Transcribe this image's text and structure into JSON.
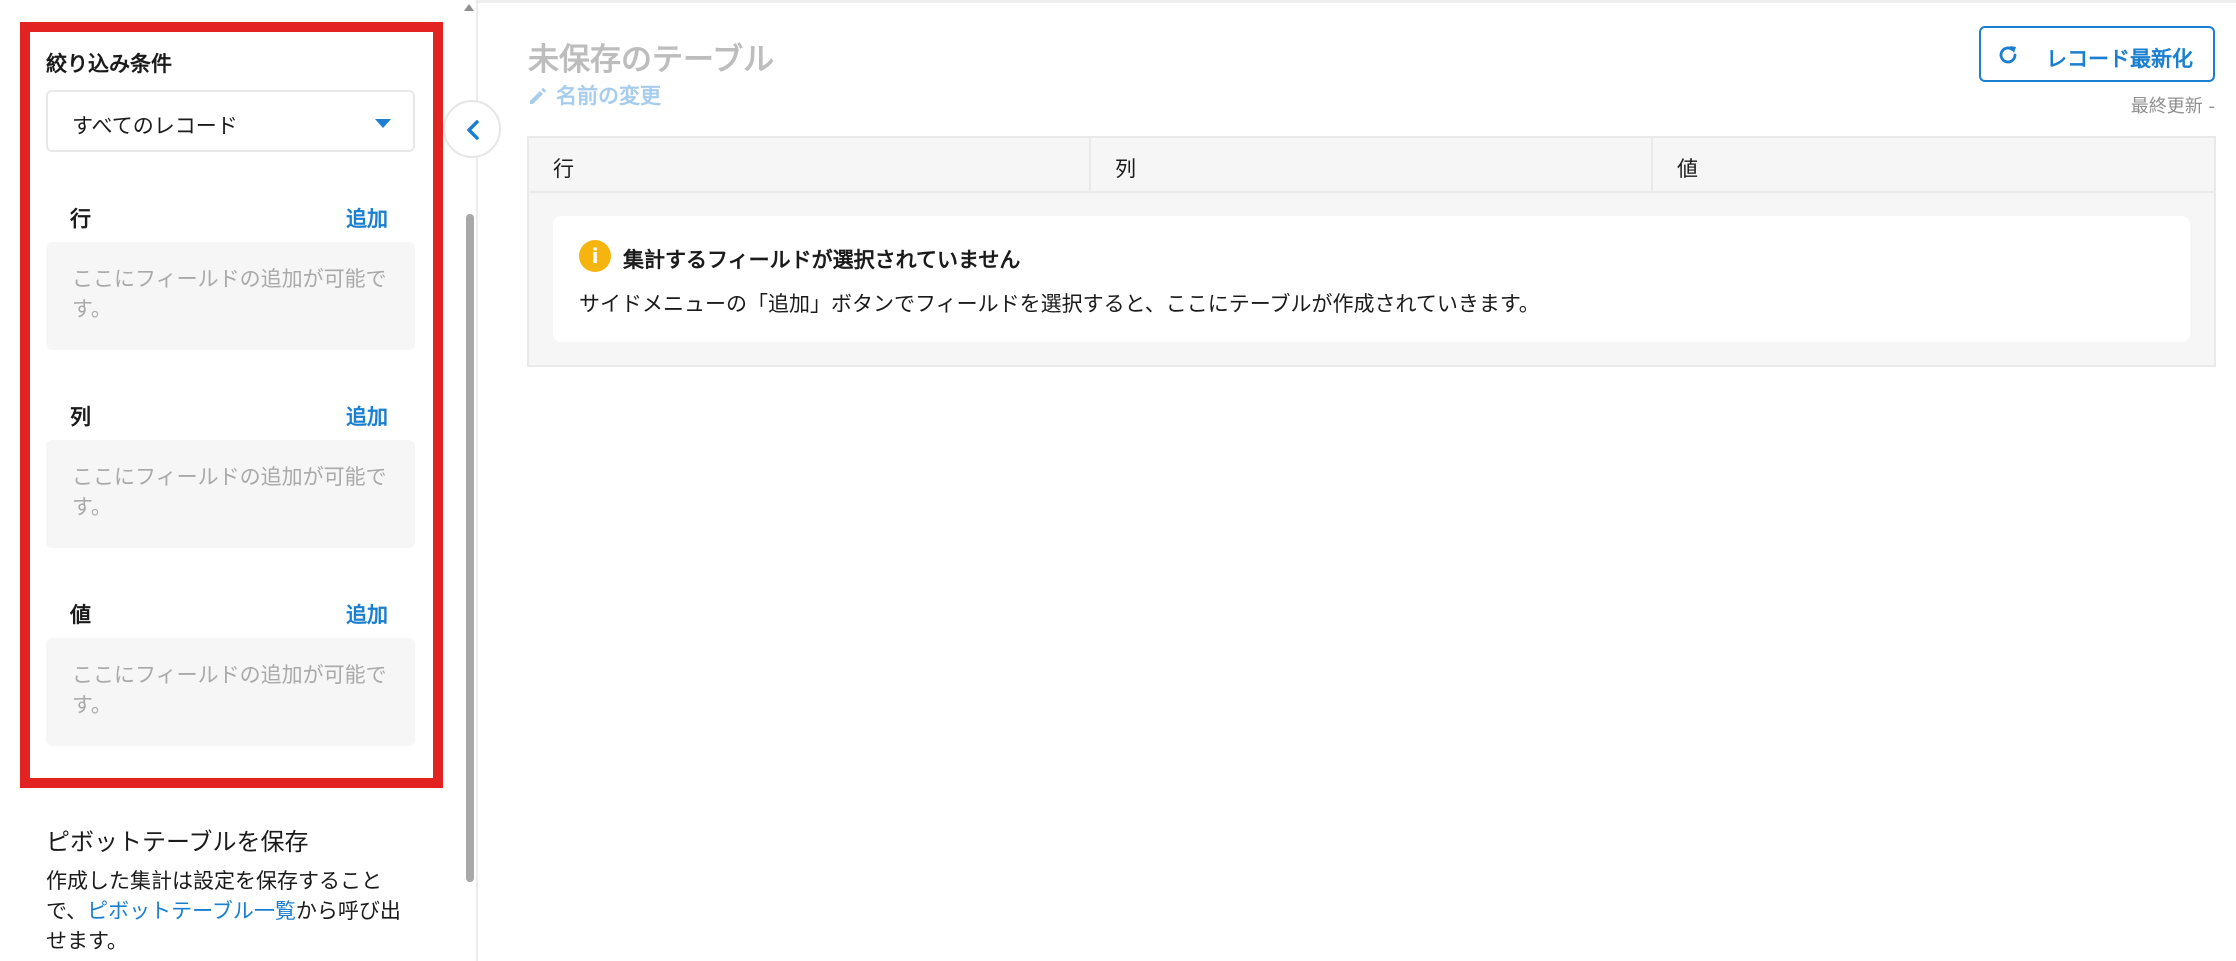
{
  "sidebar": {
    "filter_title": "絞り込み条件",
    "filter_selected": "すべてのレコード",
    "sections": [
      {
        "label": "行",
        "add_label": "追加",
        "placeholder_line1": "ここにフィールドの追加が可能で",
        "placeholder_line2": "す。"
      },
      {
        "label": "列",
        "add_label": "追加",
        "placeholder_line1": "ここにフィールドの追加が可能で",
        "placeholder_line2": "す。"
      },
      {
        "label": "値",
        "add_label": "追加",
        "placeholder_line1": "ここにフィールドの追加が可能で",
        "placeholder_line2": "す。"
      }
    ],
    "save": {
      "title": "ピボットテーブルを保存",
      "desc_line1": "作成した集計は設定を保存すること",
      "desc_line2_prefix": "で、",
      "desc_link": "ピボットテーブル一覧",
      "desc_line2_suffix": "から呼び出",
      "desc_line3": "せます。"
    }
  },
  "main": {
    "title": "未保存のテーブル",
    "rename_label": "名前の変更",
    "refresh_label": "レコード最新化",
    "last_updated": "最終更新 -",
    "table_headers": [
      "行",
      "列",
      "値"
    ],
    "notice": {
      "title": "集計するフィールドが選択されていません",
      "body": "サイドメニューの「追加」ボタンでフィールドを選択すると、ここにテーブルが作成されていきます。"
    }
  },
  "icons": {
    "caret": "caret-down-icon",
    "collapse": "chevron-left-icon",
    "rename": "pencil-icon",
    "refresh": "refresh-icon",
    "info": "info-icon"
  },
  "colors": {
    "accent": "#1a7fd0",
    "highlight": "#e32222",
    "info": "#f5b50e",
    "title_muted": "#bdbdbd"
  }
}
